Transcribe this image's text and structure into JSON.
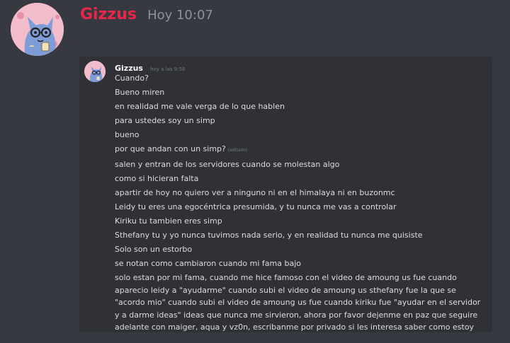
{
  "outer": {
    "author": "Gizzus",
    "timestamp": "Hoy 10:07"
  },
  "quote": {
    "author": "Gizzus",
    "timestamp": "hoy a las 9:58",
    "edited_label": "(editado)",
    "messages": [
      "Cuando?",
      "Bueno miren",
      "en realidad me vale verga de lo que hablen",
      "para ustedes soy un simp",
      "bueno",
      "por que andan con un simp?",
      "salen y entran de los servidores cuando se molestan algo",
      "como si hicieran falta",
      "apartir de hoy no quiero ver a ninguno ni en el himalaya ni en buzonmc",
      "Leidy tu eres una egocéntrica presumida, y tu nunca me vas a controlar",
      "Kiriku tu tambien eres simp",
      "Sthefany tu y yo nunca tuvimos nada serio, y en realidad tu nunca me quisiste",
      "Solo son un estorbo",
      "se notan como cambiaron cuando mi fama bajo",
      "solo estan por mi fama, cuando me hice famoso con el video de amoung us fue cuando aparecio leidy a \"ayudarme\" cuando subi el video de amoung us sthefany fue la que se \"acordo mio\" cuando subi el video de amoung us fue cuando kiriku fue \"ayudar en el servidor y a darme ideas\" ideas que nunca me sirvieron, ahora por favor dejenme en paz que seguire adelante con maiger, aqua y vz0n, escribanme por privado si les interesa saber como estoy"
    ]
  },
  "colors": {
    "background": "#36393f",
    "quote_background": "#2f3136",
    "outer_author": "#e8264a",
    "text": "#dcddde",
    "muted": "#72767d"
  },
  "icons": {
    "outer_avatar": "blue-cat-avatar",
    "inner_avatar": "blue-cat-avatar"
  }
}
